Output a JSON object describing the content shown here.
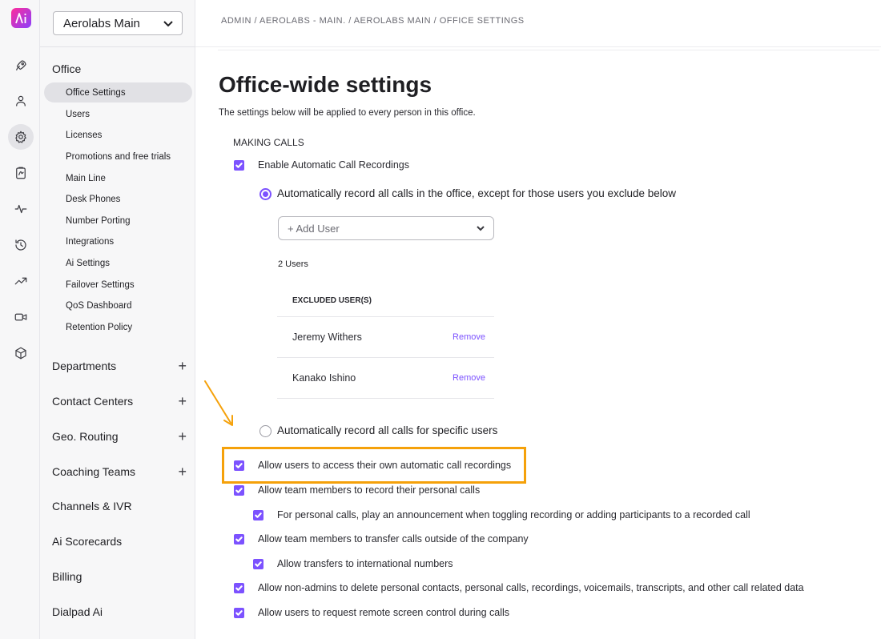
{
  "app": {
    "logo_text": "Ai",
    "office_selector": "Aerolabs Main"
  },
  "rail_icons": [
    "rocket-icon",
    "person-icon",
    "gear-icon",
    "clipboard-icon",
    "pulse-icon",
    "history-icon",
    "trend-icon",
    "video-camera-icon",
    "cube-icon"
  ],
  "sidebar": {
    "office_title": "Office",
    "office_items": [
      {
        "label": "Office Settings",
        "active": true
      },
      {
        "label": "Users"
      },
      {
        "label": "Licenses"
      },
      {
        "label": "Promotions and free trials"
      },
      {
        "label": "Main Line"
      },
      {
        "label": "Desk Phones"
      },
      {
        "label": "Number Porting"
      },
      {
        "label": "Integrations"
      },
      {
        "label": "Ai Settings"
      },
      {
        "label": "Failover Settings"
      },
      {
        "label": "QoS Dashboard"
      },
      {
        "label": "Retention Policy"
      }
    ],
    "groups": [
      {
        "label": "Departments",
        "expandable": true
      },
      {
        "label": "Contact Centers",
        "expandable": true
      },
      {
        "label": "Geo. Routing",
        "expandable": true
      },
      {
        "label": "Coaching Teams",
        "expandable": true
      },
      {
        "label": "Channels & IVR",
        "expandable": false
      },
      {
        "label": "Ai Scorecards",
        "expandable": false
      },
      {
        "label": "Billing",
        "expandable": false
      },
      {
        "label": "Dialpad Ai",
        "expandable": false
      }
    ],
    "plus_glyph": "+"
  },
  "header": {
    "breadcrumb": "ADMIN / AEROLABS - MAIN. / AEROLABS MAIN / OFFICE SETTINGS"
  },
  "main": {
    "title": "Office-wide settings",
    "subtitle": "The settings below will be applied to every person in this office.",
    "section_label": "MAKING CALLS",
    "enable_recordings": {
      "label": "Enable Automatic Call Recordings",
      "checked": true
    },
    "radio_all": {
      "label": "Automatically record all calls in the office, except for those users you exclude below",
      "selected": true
    },
    "add_user_placeholder": "+ Add User",
    "users_count": "2 Users",
    "excluded_header": "EXCLUDED USER(S)",
    "excluded_users": [
      {
        "name": "Jeremy Withers",
        "action": "Remove"
      },
      {
        "name": "Kanako Ishino",
        "action": "Remove"
      }
    ],
    "radio_specific": {
      "label": "Automatically record all calls for specific users",
      "selected": false
    },
    "options": [
      {
        "label": "Allow users to access their own automatic call recordings",
        "checked": true,
        "highlighted": true
      },
      {
        "label": "Allow team members to record their personal calls",
        "checked": true
      },
      {
        "label": "For personal calls, play an announcement when toggling recording or adding participants to a recorded call",
        "checked": true,
        "indent": true
      },
      {
        "label": "Allow team members to transfer calls outside of the company",
        "checked": true
      },
      {
        "label": "Allow transfers to international numbers",
        "checked": true,
        "indent": true
      },
      {
        "label": "Allow non-admins to delete personal contacts, personal calls, recordings, voicemails, transcripts, and other call related data",
        "checked": true
      },
      {
        "label": "Allow users to request remote screen control during calls",
        "checked": true
      }
    ]
  },
  "colors": {
    "accent": "#7c52ff",
    "highlight": "#f5a10a",
    "logo_gradient_start": "#ff2d9b",
    "logo_gradient_end": "#8a3ffc"
  }
}
